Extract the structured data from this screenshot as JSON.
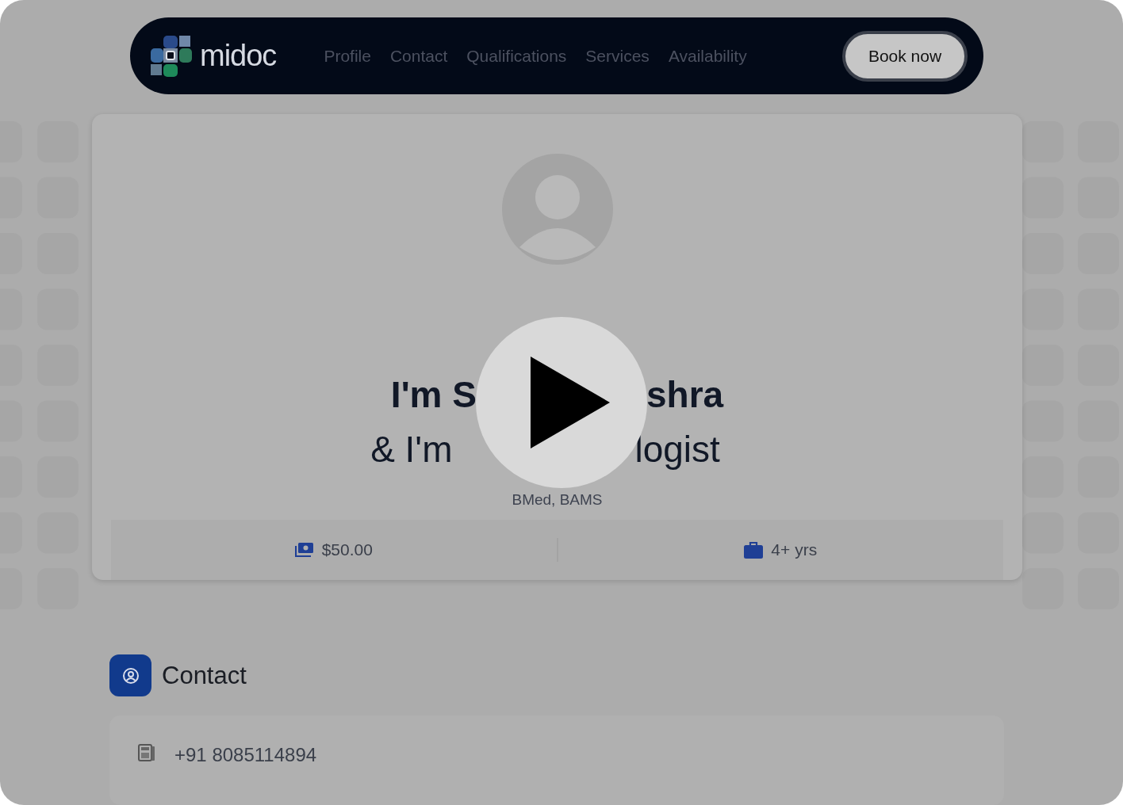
{
  "nav": {
    "logo": "midoc",
    "links": [
      {
        "label": "Profile"
      },
      {
        "label": "Contact"
      },
      {
        "label": "Qualifications"
      },
      {
        "label": "Services"
      },
      {
        "label": "Availability"
      }
    ],
    "cta": "Book now"
  },
  "profile": {
    "name_parts": [
      "I'm S",
      "shra"
    ],
    "role_parts": [
      "& I'm",
      "logist"
    ],
    "credentials": "BMed, BAMS",
    "fee": "$50.00",
    "experience": "4+ yrs"
  },
  "contact": {
    "title": "Contact",
    "phone": "+91 8085114894"
  }
}
